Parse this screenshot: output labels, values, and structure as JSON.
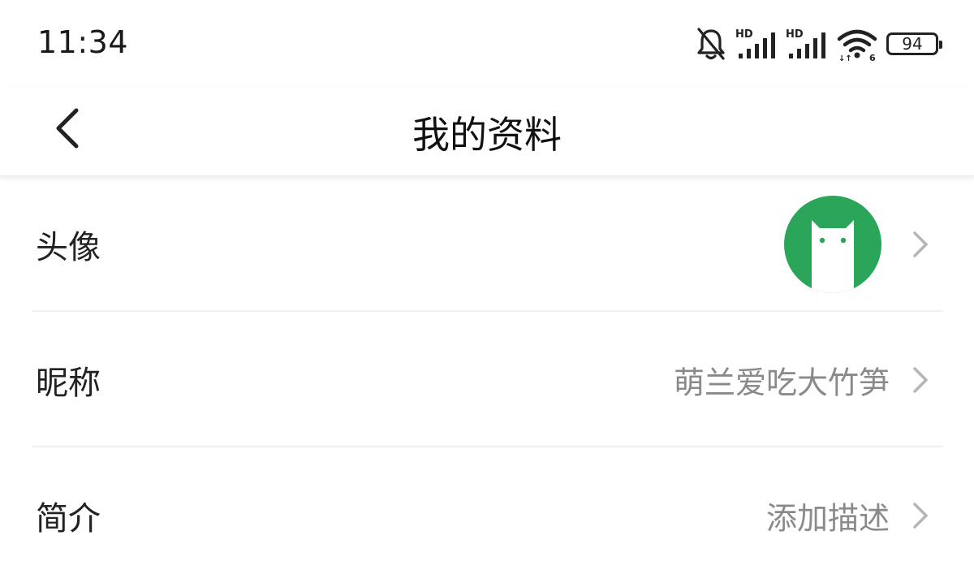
{
  "status_bar": {
    "time": "11:34",
    "battery_level": "94",
    "icons": [
      "bell-muted-icon",
      "hd-signal-icon",
      "hd-signal-icon",
      "wifi-6-icon",
      "battery-icon"
    ]
  },
  "nav": {
    "title": "我的资料",
    "back_icon": "chevron-left-icon"
  },
  "profile": {
    "rows": [
      {
        "label": "头像",
        "value": "",
        "icon": "cat-avatar-icon"
      },
      {
        "label": "昵称",
        "value": "萌兰爱吃大竹笋"
      },
      {
        "label": "简介",
        "value": "添加描述"
      }
    ]
  },
  "colors": {
    "avatar_green": "#2aa55a",
    "value_gray": "#8a8a8a",
    "divider": "#f0f0f0"
  }
}
